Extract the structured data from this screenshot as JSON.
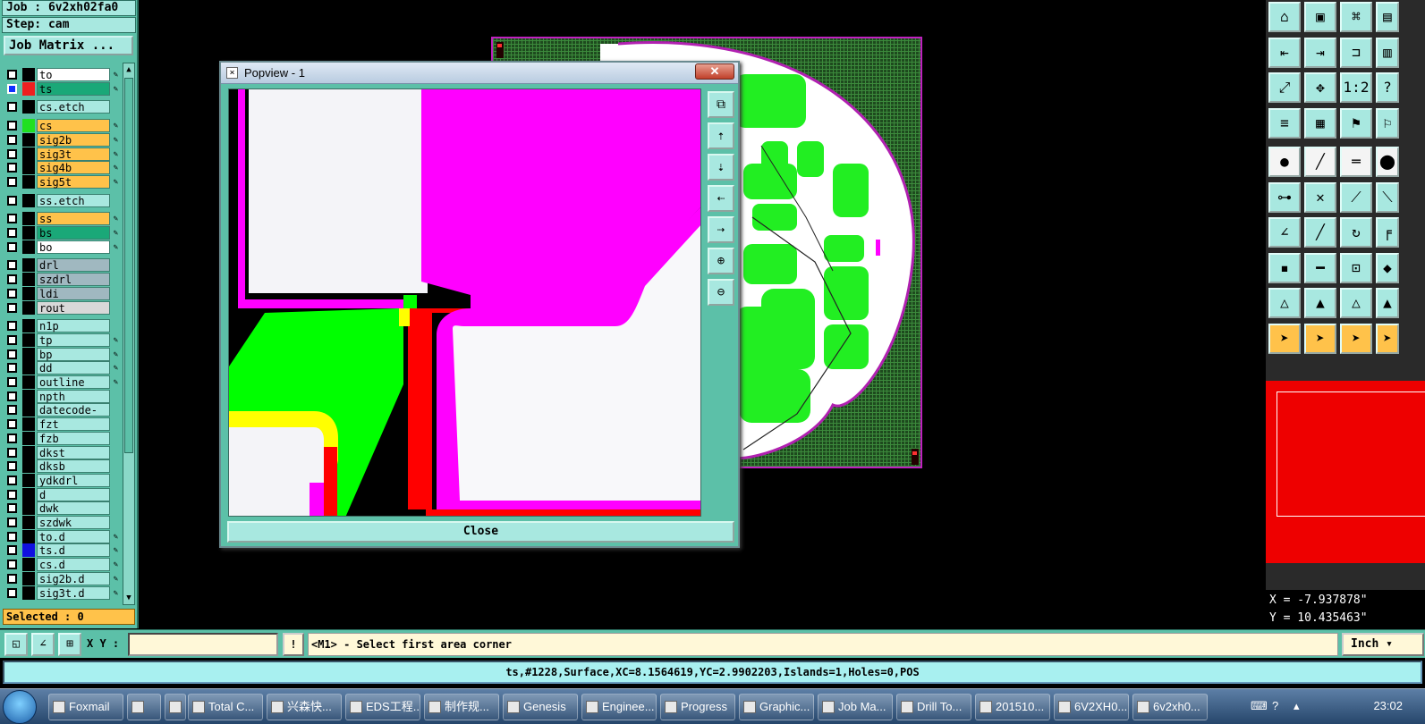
{
  "app": {
    "job_line": "Job : 6v2xh02fa0",
    "step_line": "Step: cam",
    "matrix_button": "Job Matrix ..."
  },
  "layers": [
    {
      "name": "to",
      "color": "#000000",
      "bg": "#ffffff",
      "flag": "✎",
      "checked": false
    },
    {
      "name": "ts",
      "color": "#ee2020",
      "bg": "#1aa878",
      "flag": "✎",
      "checked": true
    },
    {
      "name": "cs.etch",
      "color": "#000000",
      "bg": "#a8e8e0",
      "flag": "",
      "checked": false
    },
    {
      "name": "cs",
      "color": "#20e020",
      "bg": "#ffc24a",
      "flag": "✎",
      "checked": false
    },
    {
      "name": "sig2b",
      "color": "#000000",
      "bg": "#ffc24a",
      "flag": "✎",
      "checked": false
    },
    {
      "name": "sig3t",
      "color": "#000000",
      "bg": "#ffc24a",
      "flag": "✎",
      "checked": false
    },
    {
      "name": "sig4b",
      "color": "#000000",
      "bg": "#ffc24a",
      "flag": "✎",
      "checked": false
    },
    {
      "name": "sig5t",
      "color": "#000000",
      "bg": "#ffc24a",
      "flag": "✎",
      "checked": false
    },
    {
      "name": "ss.etch",
      "color": "#000000",
      "bg": "#a8e8e0",
      "flag": "",
      "checked": false
    },
    {
      "name": "ss",
      "color": "#000000",
      "bg": "#ffc24a",
      "flag": "✎",
      "checked": false
    },
    {
      "name": "bs",
      "color": "#000000",
      "bg": "#1aa878",
      "flag": "✎",
      "checked": false
    },
    {
      "name": "bo",
      "color": "#000000",
      "bg": "#ffffff",
      "flag": "✎",
      "checked": false
    },
    {
      "name": "drl",
      "color": "#000000",
      "bg": "#a0b8c0",
      "flag": "",
      "checked": false
    },
    {
      "name": "szdrl",
      "color": "#000000",
      "bg": "#a0b8c0",
      "flag": "",
      "checked": false
    },
    {
      "name": "ldi",
      "color": "#000000",
      "bg": "#a0b8c0",
      "flag": "",
      "checked": false
    },
    {
      "name": "rout",
      "color": "#000000",
      "bg": "#d8d8d8",
      "flag": "",
      "checked": false
    },
    {
      "name": "n1p",
      "color": "#000000",
      "bg": "#a8e8e0",
      "flag": "",
      "checked": false
    },
    {
      "name": "tp",
      "color": "#000000",
      "bg": "#a8e8e0",
      "flag": "✎",
      "checked": false
    },
    {
      "name": "bp",
      "color": "#000000",
      "bg": "#a8e8e0",
      "flag": "✎",
      "checked": false
    },
    {
      "name": "dd",
      "color": "#000000",
      "bg": "#a8e8e0",
      "flag": "✎",
      "checked": false
    },
    {
      "name": "outline",
      "color": "#000000",
      "bg": "#a8e8e0",
      "flag": "✎",
      "checked": false
    },
    {
      "name": "npth",
      "color": "#000000",
      "bg": "#a8e8e0",
      "flag": "",
      "checked": false
    },
    {
      "name": "datecode-ss",
      "color": "#000000",
      "bg": "#a8e8e0",
      "flag": "",
      "checked": false
    },
    {
      "name": "fzt",
      "color": "#000000",
      "bg": "#a8e8e0",
      "flag": "",
      "checked": false
    },
    {
      "name": "fzb",
      "color": "#000000",
      "bg": "#a8e8e0",
      "flag": "",
      "checked": false
    },
    {
      "name": "dkst",
      "color": "#000000",
      "bg": "#a8e8e0",
      "flag": "",
      "checked": false
    },
    {
      "name": "dksb",
      "color": "#000000",
      "bg": "#a8e8e0",
      "flag": "",
      "checked": false
    },
    {
      "name": "ydkdrl",
      "color": "#000000",
      "bg": "#a8e8e0",
      "flag": "",
      "checked": false
    },
    {
      "name": "d",
      "color": "#000000",
      "bg": "#a8e8e0",
      "flag": "",
      "checked": false
    },
    {
      "name": "dwk",
      "color": "#000000",
      "bg": "#a8e8e0",
      "flag": "",
      "checked": false
    },
    {
      "name": "szdwk",
      "color": "#000000",
      "bg": "#a8e8e0",
      "flag": "",
      "checked": false
    },
    {
      "name": "to.d",
      "color": "#000000",
      "bg": "#a8e8e0",
      "flag": "✎",
      "checked": false
    },
    {
      "name": "ts.d",
      "color": "#1010e0",
      "bg": "#a8e8e0",
      "flag": "✎",
      "checked": false
    },
    {
      "name": "cs.d",
      "color": "#000000",
      "bg": "#a8e8e0",
      "flag": "✎",
      "checked": false
    },
    {
      "name": "sig2b.d",
      "color": "#000000",
      "bg": "#a8e8e0",
      "flag": "✎",
      "checked": false
    },
    {
      "name": "sig3t.d",
      "color": "#000000",
      "bg": "#a8e8e0",
      "flag": "✎",
      "checked": false
    }
  ],
  "selected_line": "Selected : 0",
  "popview": {
    "title": "Popview - 1",
    "close_x": "✕",
    "close_button": "Close",
    "tools": [
      "zoom-fit-icon",
      "move-up-icon",
      "move-down-icon",
      "move-left-icon",
      "move-right-icon",
      "zoom-in-icon",
      "zoom-out-icon"
    ]
  },
  "right_toolbar": {
    "rows": [
      [
        "home-icon",
        "save-icon",
        "house-icon",
        "window-icon"
      ],
      [
        "import-icon",
        "export-icon",
        "route-icon",
        "grid-icon"
      ],
      [
        "fit-icon",
        "pan-icon",
        "scale-icon",
        "help-icon"
      ],
      [
        "measure-icon",
        "table-icon",
        "probe-icon",
        "net-icon"
      ],
      [
        "snap-icon",
        "slash-icon",
        "ruler-icon",
        "dot-icon"
      ],
      [
        "node-icon",
        "cross-icon",
        "link-icon",
        "link2-icon"
      ],
      [
        "angle-icon",
        "line-icon",
        "arc-icon",
        "bracket-icon"
      ],
      [
        "pad-icon",
        "minus-icon",
        "box-icon",
        "shapes-icon"
      ],
      [
        "tri-icon",
        "tri2-icon",
        "tri3-icon",
        "tri4-icon"
      ],
      [
        "pointer-icon",
        "pointer2-icon",
        "pointer3-icon",
        "pointer4-icon"
      ]
    ],
    "coord_x": "X = -7.937878\"",
    "coord_y": "Y = 10.435463\""
  },
  "command_bar": {
    "xy_label": "X Y :",
    "xy_value": "",
    "bang": "!",
    "prompt": "<M1> - Select first area corner",
    "unit": "Inch"
  },
  "status_bar": "ts,#1228,Surface,XC=8.1564619,YC=2.9902203,Islands=1,Holes=0,POS",
  "taskbar": {
    "items": [
      "Foxmail",
      "",
      "",
      "Total C...",
      "兴森快...",
      "EDS工程...",
      "制作规...",
      "Genesis",
      "Enginee...",
      "Progress",
      "Graphic...",
      "Job Ma...",
      "Drill To...",
      "201510...",
      "6V2XH0...",
      "6v2xh0..."
    ],
    "clock": "23:02"
  },
  "colors": {
    "panel": "#5cc0a8",
    "highlight": "#ffc24a",
    "magenta": "#ff00ff",
    "green": "#00ff00",
    "red": "#ff0000"
  }
}
